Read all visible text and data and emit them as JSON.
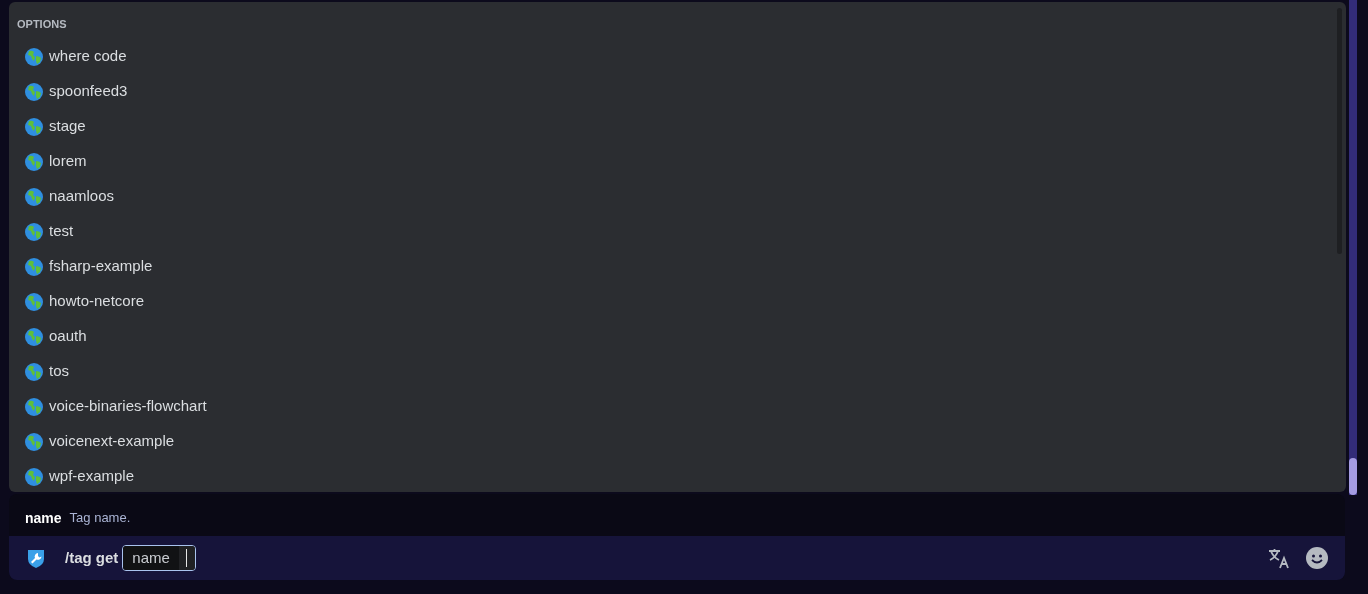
{
  "options_popup": {
    "heading": "OPTIONS",
    "items": [
      {
        "label": "where code"
      },
      {
        "label": "spoonfeed3"
      },
      {
        "label": "stage"
      },
      {
        "label": "lorem"
      },
      {
        "label": "naamloos"
      },
      {
        "label": "test"
      },
      {
        "label": "fsharp-example"
      },
      {
        "label": "howto-netcore"
      },
      {
        "label": "oauth"
      },
      {
        "label": "tos"
      },
      {
        "label": "voice-binaries-flowchart"
      },
      {
        "label": "voicenext-example"
      },
      {
        "label": "wpf-example"
      }
    ]
  },
  "option_hint": {
    "name": "name",
    "description": "Tag name."
  },
  "command_bar": {
    "command": "/tag get",
    "parameter": "name"
  }
}
